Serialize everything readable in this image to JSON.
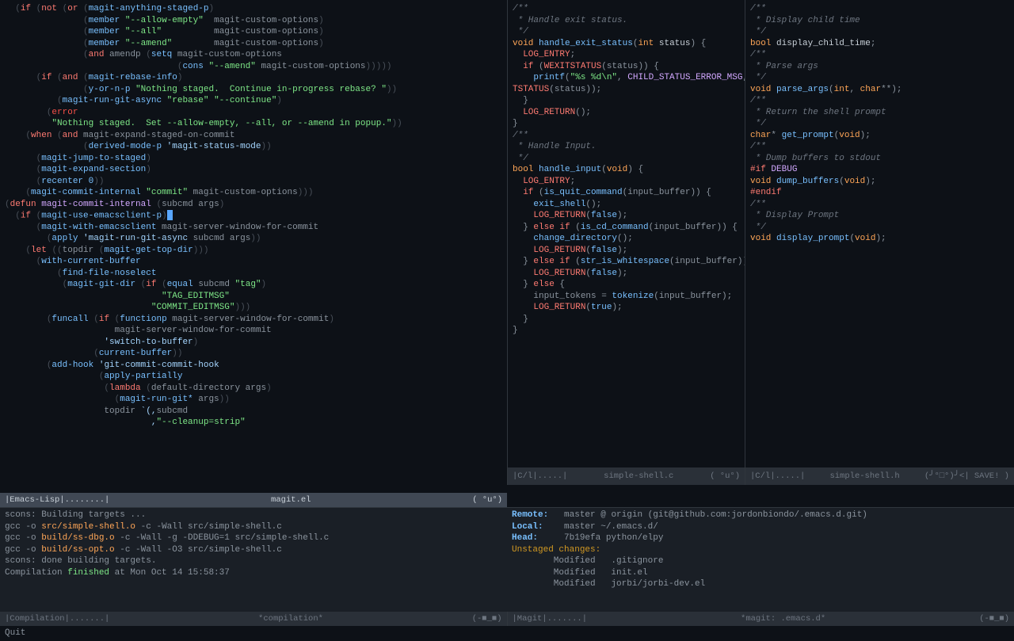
{
  "topLeft": {
    "lines": [
      {
        "t": "html",
        "h": "  <span class='c-paren'>(</span><span class='c-kw'>if</span> <span class='c-paren'>(</span><span class='c-kw'>not</span> <span class='c-paren'>(</span><span class='c-kw'>or</span> <span class='c-paren'>(</span><span class='c-fn'>magit-anything-staged-p</span><span class='c-paren'>)</span>"
      },
      {
        "t": "html",
        "h": "               <span class='c-paren'>(</span><span class='c-fn'>member</span> <span class='c-str'>\"--allow-empty\"</span>  magit-custom-options<span class='c-paren'>)</span>"
      },
      {
        "t": "html",
        "h": "               <span class='c-paren'>(</span><span class='c-fn'>member</span> <span class='c-str'>\"--all\"</span>          magit-custom-options<span class='c-paren'>)</span>"
      },
      {
        "t": "html",
        "h": "               <span class='c-paren'>(</span><span class='c-fn'>member</span> <span class='c-str'>\"--amend\"</span>        magit-custom-options<span class='c-paren'>)</span>"
      },
      {
        "t": "html",
        "h": "               <span class='c-paren'>(</span><span class='c-kw'>and</span> amendp <span class='c-paren'>(</span><span class='c-fn'>setq</span> magit-custom-options"
      },
      {
        "t": "html",
        "h": "                                 <span class='c-paren'>(</span><span class='c-fn'>cons</span> <span class='c-str'>\"--amend\"</span> magit-custom-options<span class='c-paren'>)))))</span>"
      },
      {
        "t": "html",
        "h": "      <span class='c-paren'>(</span><span class='c-kw'>if</span> <span class='c-paren'>(</span><span class='c-kw'>and</span> <span class='c-paren'>(</span><span class='c-fn'>magit-rebase-info</span><span class='c-paren'>)</span>"
      },
      {
        "t": "html",
        "h": "               <span class='c-paren'>(</span><span class='c-fn'>y-or-n-p</span> <span class='c-str'>\"Nothing staged.  Continue in-progress rebase? \"</span><span class='c-paren'>))</span>"
      },
      {
        "t": "html",
        "h": "          <span class='c-paren'>(</span><span class='c-fn'>magit-run-git-async</span> <span class='c-str'>\"rebase\"</span> <span class='c-str'>\"--continue\"</span><span class='c-paren'>)</span>"
      },
      {
        "t": "html",
        "h": "        <span class='c-paren'>(</span><span class='c-err'>error</span>"
      },
      {
        "t": "html",
        "h": "         <span class='c-str'>\"Nothing staged.  Set --allow-empty, --all, or --amend in popup.\"</span><span class='c-paren'>))</span>"
      },
      {
        "t": "html",
        "h": "    <span class='c-paren'>(</span><span class='c-kw'>when</span> <span class='c-paren'>(</span><span class='c-kw'>and</span> magit-expand-staged-on-commit"
      },
      {
        "t": "html",
        "h": "               <span class='c-paren'>(</span><span class='c-fn'>derived-mode-p</span> <span class='c-const'>'magit-status-mode</span><span class='c-paren'>))</span>"
      },
      {
        "t": "html",
        "h": "      <span class='c-paren'>(</span><span class='c-fn'>magit-jump-to-staged</span><span class='c-paren'>)</span>"
      },
      {
        "t": "html",
        "h": "      <span class='c-paren'>(</span><span class='c-fn'>magit-expand-section</span><span class='c-paren'>)</span>"
      },
      {
        "t": "html",
        "h": "      <span class='c-paren'>(</span><span class='c-fn'>recenter</span> <span class='c-num'>0</span><span class='c-paren'>))</span>"
      },
      {
        "t": "html",
        "h": "    <span class='c-paren'>(</span><span class='c-fn'>magit-commit-internal</span> <span class='c-str'>\"commit\"</span> magit-custom-options<span class='c-paren'>)))</span>"
      },
      {
        "t": "html",
        "h": ""
      },
      {
        "t": "html",
        "h": "<span class='c-paren'>(</span><span class='c-kw'>defun</span> <span class='c-def'>magit-commit-internal</span> <span class='c-paren'>(</span>subcmd args<span class='c-paren'>)</span>"
      },
      {
        "t": "html",
        "h": "  <span class='c-paren'>(</span><span class='c-kw'>if</span> <span class='c-paren'>(</span><span class='c-fn'>magit-use-emacsclient-p</span><span class='c-paren'>)</span><span class='cursor'></span>"
      },
      {
        "t": "html",
        "h": "      <span class='c-paren'>(</span><span class='c-fn'>magit-with-emacsclient</span> magit-server-window-for-commit"
      },
      {
        "t": "html",
        "h": "        <span class='c-paren'>(</span><span class='c-fn'>apply</span> <span class='c-const'>'magit-run-git-async</span> subcmd args<span class='c-paren'>))</span>"
      },
      {
        "t": "html",
        "h": "    <span class='c-paren'>(</span><span class='c-kw'>let</span> <span class='c-paren'>((</span>topdir <span class='c-paren'>(</span><span class='c-fn'>magit-get-top-dir</span><span class='c-paren'>)))</span>"
      },
      {
        "t": "html",
        "h": "      <span class='c-paren'>(</span><span class='c-fn'>with-current-buffer</span>"
      },
      {
        "t": "html",
        "h": "          <span class='c-paren'>(</span><span class='c-fn'>find-file-noselect</span>"
      },
      {
        "t": "html",
        "h": "           <span class='c-paren'>(</span><span class='c-fn'>magit-git-dir</span> <span class='c-paren'>(</span><span class='c-kw'>if</span> <span class='c-paren'>(</span><span class='c-fn'>equal</span> subcmd <span class='c-str'>\"tag\"</span><span class='c-paren'>)</span>"
      },
      {
        "t": "html",
        "h": "                              <span class='c-str'>\"TAG_EDITMSG\"</span>"
      },
      {
        "t": "html",
        "h": "                            <span class='c-str'>\"COMMIT_EDITMSG\"</span><span class='c-paren'>)))</span>"
      },
      {
        "t": "html",
        "h": "        <span class='c-paren'>(</span><span class='c-fn'>funcall</span> <span class='c-paren'>(</span><span class='c-kw'>if</span> <span class='c-paren'>(</span><span class='c-fn'>functionp</span> magit-server-window-for-commit<span class='c-paren'>)</span>"
      },
      {
        "t": "html",
        "h": "                     magit-server-window-for-commit"
      },
      {
        "t": "html",
        "h": "                   <span class='c-const'>'switch-to-buffer</span><span class='c-paren'>)</span>"
      },
      {
        "t": "html",
        "h": "                 <span class='c-paren'>(</span><span class='c-fn'>current-buffer</span><span class='c-paren'>))</span>"
      },
      {
        "t": "html",
        "h": "        <span class='c-paren'>(</span><span class='c-fn'>add-hook</span> <span class='c-const'>'git-commit-commit-hook</span>"
      },
      {
        "t": "html",
        "h": "                  <span class='c-paren'>(</span><span class='c-fn'>apply-partially</span>"
      },
      {
        "t": "html",
        "h": "                   <span class='c-paren'>(</span><span class='c-kw'>lambda</span> <span class='c-paren'>(</span>default-directory args<span class='c-paren'>)</span>"
      },
      {
        "t": "html",
        "h": "                     <span class='c-paren'>(</span><span class='c-fn'>magit-run-git*</span> args<span class='c-paren'>))</span>"
      },
      {
        "t": "html",
        "h": "                   topdir <span class='c-const'>`(,</span>subcmd"
      },
      {
        "t": "html",
        "h": "                            <span class='c-const'>,</span><span class='c-str'>\"--cleanup=strip\"</span>"
      }
    ]
  },
  "topLeftModeline": {
    "mode": "|Emacs-Lisp|........|",
    "buffer": "magit.el",
    "pos": "( °u°)"
  },
  "topRightC": {
    "lines": [
      {
        "h": "<span class='c-comment'>/**</span>"
      },
      {
        "h": "<span class='c-comment'> * Handle exit status.</span>"
      },
      {
        "h": "<span class='c-comment'> */</span>"
      },
      {
        "h": "<span class='c-type'>void</span> <span class='c-fn'>handle_exit_status</span>(<span class='c-type'>int</span> <span class='c-var'>status</span>) {"
      },
      {
        "h": "  <span class='c-macro'>LOG_ENTRY</span>;"
      },
      {
        "h": "  <span class='c-kw'>if</span> (<span class='c-macro'>WEXITSTATUS</span>(status)) {"
      },
      {
        "h": "    <span class='c-fn'>printf</span>(<span class='c-str'>\"%s %d\\n\"</span>, <span class='c-def'>CHILD_STATUS_ERROR_MSG</span>, <span class='c-macro'>WEXI\\</span>"
      },
      {
        "h": "<span class='c-macro'>TSTATUS</span>(status));"
      },
      {
        "h": "  }"
      },
      {
        "h": "  <span class='c-macro'>LOG_RETURN</span>();"
      },
      {
        "h": "}"
      },
      {
        "h": ""
      },
      {
        "h": ""
      },
      {
        "h": "<span class='c-comment'>/**</span>"
      },
      {
        "h": "<span class='c-comment'> * Handle Input.</span>"
      },
      {
        "h": "<span class='c-comment'> */</span>"
      },
      {
        "h": "<span class='c-type'>bool</span> <span class='c-fn'>handle_input</span>(<span class='c-type'>void</span>) {"
      },
      {
        "h": "  <span class='c-macro'>LOG_ENTRY</span>;"
      },
      {
        "h": "  <span class='c-kw'>if</span> (<span class='c-fn'>is_quit_command</span>(input_buffer)) {"
      },
      {
        "h": "    <span class='c-fn'>exit_shell</span>();"
      },
      {
        "h": "    <span class='c-macro'>LOG_RETURN</span>(<span class='c-bool'>false</span>);"
      },
      {
        "h": "  } <span class='c-kw'>else if</span> (<span class='c-fn'>is_cd_command</span>(input_buffer)) {"
      },
      {
        "h": "    <span class='c-fn'>change_directory</span>();"
      },
      {
        "h": "    <span class='c-macro'>LOG_RETURN</span>(<span class='c-bool'>false</span>);"
      },
      {
        "h": "  } <span class='c-kw'>else if</span> (<span class='c-fn'>str_is_whitespace</span>(input_buffer)) {"
      },
      {
        "h": "    <span class='c-macro'>LOG_RETURN</span>(<span class='c-bool'>false</span>);"
      },
      {
        "h": "  } <span class='c-kw'>else</span> {"
      },
      {
        "h": "    input_tokens = <span class='c-fn'>tokenize</span>(input_buffer);"
      },
      {
        "h": "    <span class='c-macro'>LOG_RETURN</span>(<span class='c-bool'>true</span>);"
      },
      {
        "h": "  }"
      },
      {
        "h": "}"
      }
    ]
  },
  "topRightH": {
    "lines": [
      {
        "h": "<span class='c-comment'>/**</span>"
      },
      {
        "h": "<span class='c-comment'> * Display child time</span>"
      },
      {
        "h": "<span class='c-comment'> */</span>"
      },
      {
        "h": "<span class='c-type'>bool</span> <span class='c-var'>display_child_time</span>;"
      },
      {
        "h": ""
      },
      {
        "h": ""
      },
      {
        "h": "<span class='c-comment'>/**</span>"
      },
      {
        "h": "<span class='c-comment'> * Parse args</span>"
      },
      {
        "h": "<span class='c-comment'> */</span>"
      },
      {
        "h": "<span class='c-type'>void</span> <span class='c-fn'>parse_args</span>(<span class='c-type'>int</span>, <span class='c-type'>char</span>**);"
      },
      {
        "h": ""
      },
      {
        "h": ""
      },
      {
        "h": "<span class='c-comment'>/**</span>"
      },
      {
        "h": "<span class='c-comment'> * Return the shell prompt</span>"
      },
      {
        "h": "<span class='c-comment'> */</span>"
      },
      {
        "h": "<span class='c-type'>char</span>* <span class='c-fn'>get_prompt</span>(<span class='c-type'>void</span>);"
      },
      {
        "h": ""
      },
      {
        "h": "<span class='c-comment'>/**</span>"
      },
      {
        "h": "<span class='c-comment'> * Dump buffers to stdout</span>"
      },
      {
        "h": "<span class='c-macro'>#if</span> <span class='c-def'>DEBUG</span>"
      },
      {
        "h": "<span class='c-type'>void</span> <span class='c-fn'>dump_buffers</span>(<span class='c-type'>void</span>);"
      },
      {
        "h": "<span class='c-macro'>#endif</span>"
      },
      {
        "h": ""
      },
      {
        "h": "<span class='c-comment'>/**</span>"
      },
      {
        "h": "<span class='c-comment'> * Display Prompt</span>"
      },
      {
        "h": "<span class='c-comment'> */</span>"
      },
      {
        "h": "<span class='c-type'>void</span> <span class='c-fn'>display_prompt</span>(<span class='c-type'>void</span>);"
      }
    ]
  },
  "trcModeline": {
    "mode": "|C/l|.....|",
    "buffer": "simple-shell.c",
    "pos": "( °u°)"
  },
  "trhModeline": {
    "mode": "|C/l|.....|",
    "buffer": "simple-shell.h",
    "pos": "(╯°□°)╯<| SAVE! )"
  },
  "botLeft": {
    "lines": [
      "scons: Building targets ...",
      "gcc -o src/simple-shell.o -c -Wall src/simple-shell.c",
      "gcc -o build/ss-dbg.o -c -Wall -g -DDEBUG=1 src/simple-shell.c",
      "gcc -o build/ss-opt.o -c -Wall -O3 src/simple-shell.c",
      "scons: done building targets.",
      "",
      "Compilation finished at Mon Oct 14 15:58:37"
    ]
  },
  "botRight": {
    "remote": "Remote:",
    "remoteVal": "master @ origin (git@github.com:jordonbiondo/.emacs.d.git)",
    "local": "Local:",
    "localVal": "master ~/.emacs.d/",
    "head": "Head:",
    "headVal": "7b19efa python/elpy",
    "unstaged": "Unstaged changes:",
    "changes": [
      "Modified   .gitignore",
      "Modified   init.el",
      "Modified   jorbi/jorbi-dev.el"
    ]
  },
  "blModeline": {
    "mode": "|Compilation|.......|",
    "buffer": "*compilation*",
    "pos": "(-■_■)"
  },
  "brModeline": {
    "mode": "|Magit|.......|",
    "buffer": "*magit: .emacs.d*",
    "pos": "(-■_■)"
  },
  "minibuf": "Quit"
}
